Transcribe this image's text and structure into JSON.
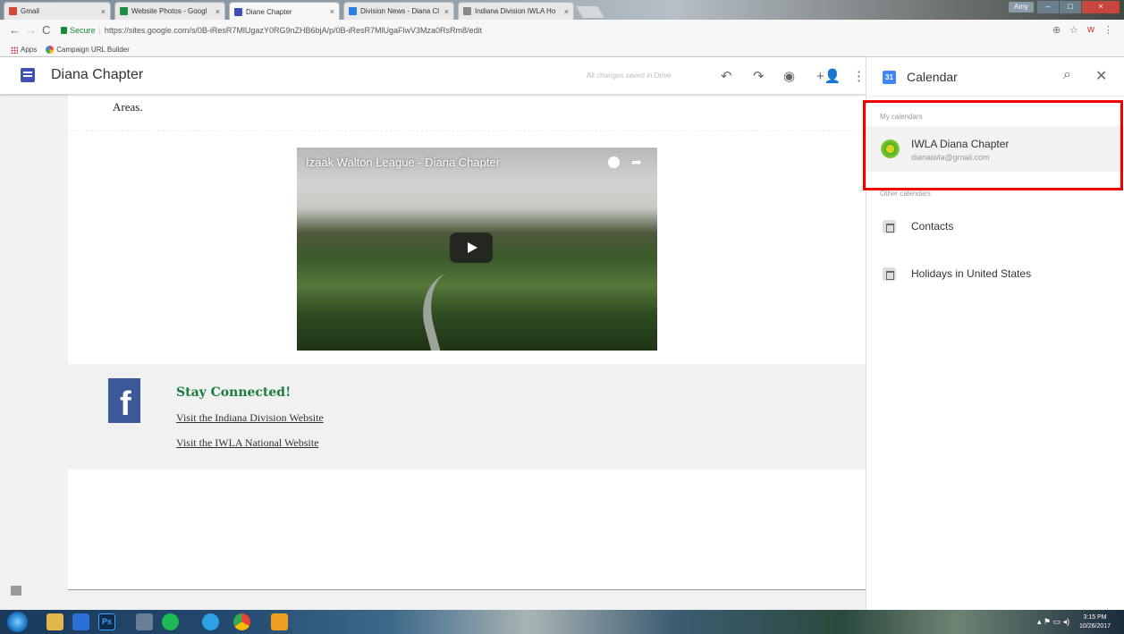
{
  "browser": {
    "tabs": [
      {
        "label": "Gmail",
        "fav": "#d44638",
        "close": "×"
      },
      {
        "label": "Website Photos - Googl",
        "fav": "#1e8e3e",
        "close": "×"
      },
      {
        "label": "Diane Chapter",
        "fav": "#3f51b5",
        "close": "×"
      },
      {
        "label": "Division News - Diana Cl",
        "fav": "#2a7de1",
        "close": "×"
      },
      {
        "label": "Indiana Division IWLA Ho",
        "fav": "#888888",
        "close": "×"
      }
    ],
    "user_label": "Amy",
    "secure_label": "Secure",
    "url": "https://sites.google.com/s/0B-iResR7MlUgazY0RG9nZHB6bjA/p/0B-iResR7MlUgaFlwV3Mza0RsRm8/edit",
    "bookmarks": {
      "apps": "Apps",
      "campaign": "Campaign URL Builder"
    }
  },
  "site": {
    "title": "Diana Chapter",
    "saved_status": "All changes saved in Drive",
    "intro_text": "Areas.",
    "video_title": "Izaak Walton League - Diana Chapter",
    "stay_connected": "Stay Connected!",
    "link_indiana": "Visit the Indiana Division Website",
    "link_national": "Visit the IWLA National Website",
    "fb_letter": "f"
  },
  "calendar": {
    "icon_text": "31",
    "title": "Calendar",
    "my_calendars_label": "My calendars",
    "other_calendars_label": "Other calendars",
    "my_calendars": [
      {
        "name": "IWLA Diana Chapter",
        "email": "dianaiwla@gmail.com"
      }
    ],
    "other_calendars": [
      {
        "name": "Contacts"
      },
      {
        "name": "Holidays in United States"
      }
    ]
  },
  "taskbar": {
    "ps_label": "Ps",
    "clock_time": "3:15 PM",
    "clock_date": "10/26/2017"
  }
}
